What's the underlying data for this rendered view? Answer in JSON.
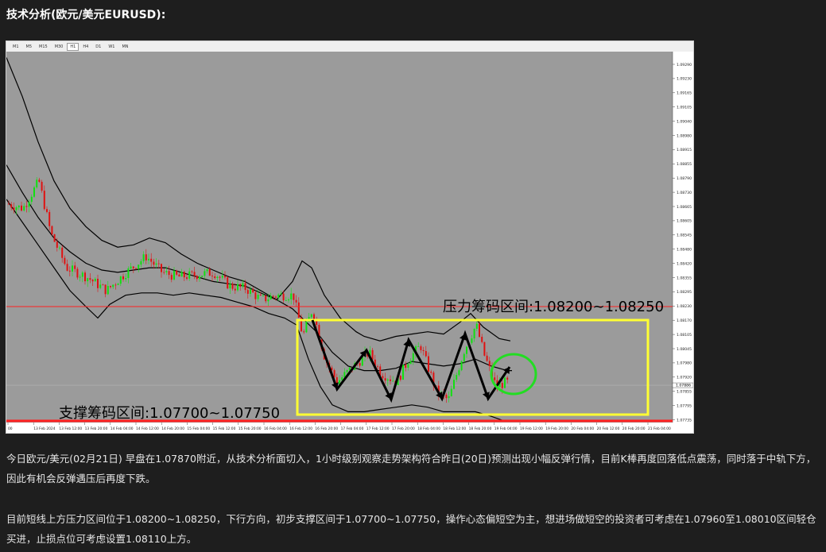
{
  "heading": "技术分析(欧元/美元EURUSD):",
  "timeframes": [
    {
      "label": "M1",
      "active": false
    },
    {
      "label": "M5",
      "active": false
    },
    {
      "label": "M15",
      "active": false
    },
    {
      "label": "M30",
      "active": false
    },
    {
      "label": "H1",
      "active": true
    },
    {
      "label": "H4",
      "active": false
    },
    {
      "label": "D1",
      "active": false
    },
    {
      "label": "W1",
      "active": false
    },
    {
      "label": "MN",
      "active": false
    }
  ],
  "annotations": {
    "resistance": "压力筹码区间:1.08200~1.08250",
    "support": "支撑筹码区间:1.07700~1.07750"
  },
  "chart_data": {
    "type": "candlestick",
    "y_ticks": [
      "1.09290",
      "1.09230",
      "1.09165",
      "1.09105",
      "1.09040",
      "1.08980",
      "1.08915",
      "1.08855",
      "1.08790",
      "1.08730",
      "1.08665",
      "1.08605",
      "1.08545",
      "1.08480",
      "1.08420",
      "1.08355",
      "1.08295",
      "1.08230",
      "1.08170",
      "1.08105",
      "1.08045",
      "1.07980",
      "1.07920",
      "1.07855",
      "1.07795",
      "1.07735"
    ],
    "current_price": "1.07886",
    "x_ticks": [
      "00",
      "13 Feb 2024",
      "13 Feb 12:00",
      "13 Feb 20:00",
      "14 Feb 04:00",
      "14 Feb 12:00",
      "14 Feb 20:00",
      "15 Feb 04:00",
      "15 Feb 12:00",
      "15 Feb 20:00",
      "16 Feb 04:00",
      "16 Feb 12:00",
      "16 Feb 20:00",
      "17 Feb 04:00",
      "17 Feb 12:00",
      "17 Feb 20:00",
      "18 Feb 04:00",
      "18 Feb 12:00",
      "18 Feb 20:00",
      "19 Feb 04:00",
      "19 Feb 12:00",
      "19 Feb 20:00",
      "20 Feb 04:00",
      "20 Feb 12:00",
      "20 Feb 20:00",
      "21 Feb 04:00"
    ],
    "resistance_range": [
      1.082,
      1.0825
    ],
    "support_range": [
      1.077,
      1.0775
    ],
    "colors": {
      "up": "#11e011",
      "down": "#e01111",
      "band": "#000000",
      "level": "#ff2020",
      "box": "#ffff33",
      "circle": "#22dd22"
    }
  },
  "paragraphs": [
    "今日欧元/美元(02月21日) 早盘在1.07870附近，从技术分析面切入，1小时级别观察走势架构符合昨日(20日)预测出现小幅反弹行情，目前K棒再度回落低点震荡，同时落于中轨下方，因此有机会反弹遇压后再度下跌。",
    "目前短线上方压力区间位于1.08200~1.08250，下行方向，初步支撑区间于1.07700~1.07750，操作心态偏短空为主，想进场做短空的投资者可考虑在1.07960至1.08010区间轻仓买进，止损点位可考虑设置1.08110上方。"
  ]
}
